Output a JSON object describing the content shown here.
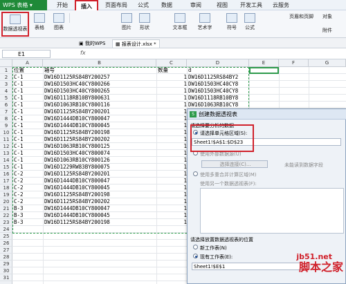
{
  "app": {
    "menu_label": "WPS 表格",
    "tabs": [
      "开始",
      "插入",
      "页面布局",
      "公式",
      "数据",
      "审阅",
      "视图",
      "开发工具",
      "云服务"
    ]
  },
  "ribbon": {
    "pivot_label": "数据透视表",
    "table_label": "表格",
    "picture_label": "图片",
    "shapes_label": "形状",
    "chart_label": "图表",
    "textbox_label": "文本框",
    "wordart_label": "艺术字",
    "symbol_label": "符号",
    "formula_label": "公式",
    "header_footer_label": "页眉和页脚",
    "object_label": "对象",
    "attachment_label": "附件"
  },
  "docbar": {
    "mywps": "我的WPS",
    "file": "报表设计.xlsx *"
  },
  "formula_bar": {
    "name_box": "E1",
    "fx": "fx",
    "value": ""
  },
  "sheet": {
    "columns": [
      "A",
      "B",
      "C",
      "D",
      "E",
      "F",
      "G"
    ],
    "rows": [
      [
        "位置",
        "箱号",
        "数量",
        "d"
      ],
      [
        "C-1",
        "DW16D1125RS84BY200257",
        "1",
        "DW16D1125RS84BY2"
      ],
      [
        "C-1",
        "DW16D1503HC40CY800266",
        "1",
        "DW16D1503HC40CY8"
      ],
      [
        "C-1",
        "DW16D1503HC40CY800265",
        "1",
        "DW16D1503HC40CY8"
      ],
      [
        "C-1",
        "DW16D1118RB10BY800631",
        "1",
        "DW16D1118RB10BY8"
      ],
      [
        "C-1",
        "DW16D1063RB10CY800116",
        "1",
        "DW16D1063RB10CY8"
      ],
      [
        "C-1",
        "DW16D1125RS84BY200201",
        "1",
        "DW16D1125RS84BY2"
      ],
      [
        "C-1",
        "DW16D1444DB10CY800047",
        "1",
        "DW16D1444DB10CY8"
      ],
      [
        "C-1",
        "DW16D1444DB10CY800045",
        "1",
        "DW16D1444DB10CY8"
      ],
      [
        "C-1",
        "DW16D1125RS84BY200198",
        "1",
        "DW16D1125RS84BY2"
      ],
      [
        "C-1",
        "DW16D1125RS84BY200202",
        "1",
        "DW16D1125RS84BY2"
      ],
      [
        "C-1",
        "DW16D1063RB10CY800125",
        "1",
        "DW16D1063RB10CY8"
      ],
      [
        "C-1",
        "DW16D1503HC40CY800074",
        "1",
        "DW16D1503HC40CY8"
      ],
      [
        "C-1",
        "DW16D1063RB10CY800126",
        "1",
        "DW16D1063RB10CY8"
      ],
      [
        "C-1",
        "DW16D1229RW83BY800075",
        "1",
        "DW16D1229RW83BY8"
      ],
      [
        "C-2",
        "DW16D1125RS84BY200201",
        "1",
        "DW16D1125RS84BY2"
      ],
      [
        "C-2",
        "DW16D1444DB10CY800047",
        "1",
        "DW16D1444DB10CY8"
      ],
      [
        "C-2",
        "DW16D1444DB10CY800045",
        "1",
        "DW16D1444DB10CY8"
      ],
      [
        "C-2",
        "DW16D1125RS84BY200198",
        "1",
        "DW16D1125RS84BY2"
      ],
      [
        "C-2",
        "DW16D1125RS84BY200202",
        "1",
        "DW16D1125RS84BY2"
      ],
      [
        "B-3",
        "DW16D1444DB10CY800047",
        "1",
        "DW16D1444DB10CY8"
      ],
      [
        "B-3",
        "DW16D1444DB10CY800045",
        "1",
        "DW16D1444DB10CY8"
      ],
      [
        "B-3",
        "DW16D1125RS84BY200198",
        "1",
        "DW16D1125RS84BY2"
      ],
      [
        "",
        "",
        "",
        ""
      ],
      [
        "",
        "",
        "",
        ""
      ],
      [
        "",
        "",
        "",
        ""
      ],
      [
        "",
        "",
        "",
        ""
      ],
      [
        "",
        "",
        "",
        ""
      ],
      [
        "",
        "",
        "",
        ""
      ],
      [
        "",
        "",
        "",
        ""
      ],
      [
        "",
        "",
        "",
        ""
      ]
    ]
  },
  "dialog": {
    "title": "创建数据透视表",
    "section1": "请选择要分析的数据",
    "opt_range": "请选择单元格区域(S):",
    "range_value": "Sheet1!$A$1:$D$23",
    "opt_external": "使用外部数据源(U)",
    "choose_conn": "选择连接(C)...",
    "no_fields": "未能读到数据字段",
    "opt_multi": "使用多重合并计算区域(M)",
    "opt_other": "使用另一个数据透视表(F):",
    "section2": "请选择放置数据透视表的位置",
    "opt_new_sheet": "新工作表(N)",
    "opt_existing": "现有工作表(E):",
    "location_value": "Sheet1!$E$1"
  },
  "watermark": {
    "url": "jb51.net",
    "text": "脚本之家"
  },
  "colors": {
    "wps_green": "#1f8a38",
    "selection_green": "#2c9a4a",
    "highlight_red": "#d0202a"
  }
}
